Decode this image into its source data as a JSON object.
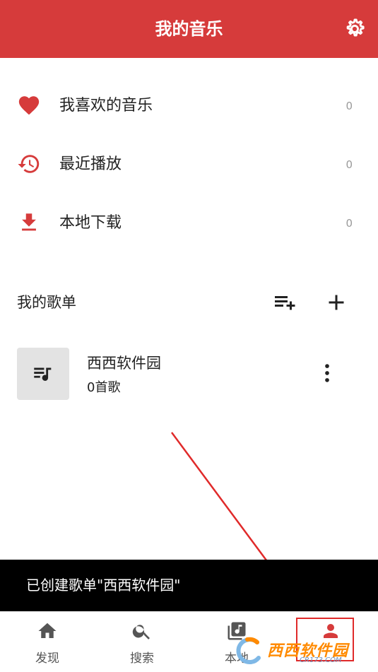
{
  "header": {
    "title": "我的音乐",
    "settings_icon": "gear-icon"
  },
  "menu": [
    {
      "label": "我喜欢的音乐",
      "count": "0",
      "icon": "heart-icon"
    },
    {
      "label": "最近播放",
      "count": "0",
      "icon": "history-icon"
    },
    {
      "label": "本地下载",
      "count": "0",
      "icon": "download-icon"
    }
  ],
  "playlists_section": {
    "title": "我的歌单",
    "add_to_playlist_icon": "playlist-add-icon",
    "create_icon": "plus-icon",
    "items": [
      {
        "name": "西西软件园",
        "subtitle": "0首歌",
        "icon": "playlist-music-icon"
      }
    ]
  },
  "snackbar": {
    "text": "已创建歌单\"西西软件园\""
  },
  "bottom_nav": {
    "items": [
      {
        "label": "发现",
        "icon": "home-icon"
      },
      {
        "label": "搜索",
        "icon": "search-icon"
      },
      {
        "label": "本地",
        "icon": "music-library-icon"
      },
      {
        "label": "我的",
        "icon": "person-icon",
        "active": true
      }
    ]
  },
  "watermark": {
    "brand": "西西软件园",
    "url": "CR173.COM"
  },
  "colors": {
    "accent": "#d63b3b",
    "snackbar": "#000000",
    "icon_gray": "#555555",
    "highlight_box": "#e02a2a"
  }
}
